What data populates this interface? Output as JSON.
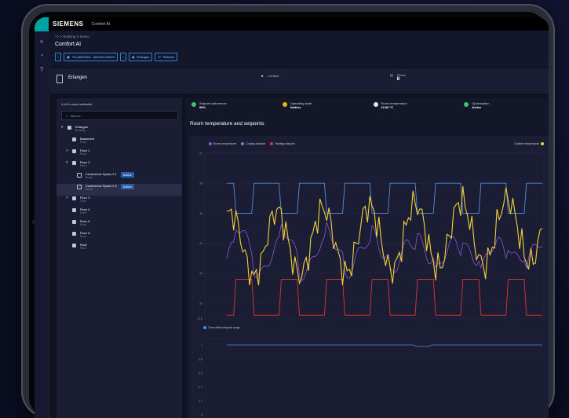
{
  "topbar": {
    "brand": "SIEMENS",
    "app": "Comfort AI"
  },
  "header": {
    "breadcrumb": ">> > Building X Demo",
    "title": "Comfort AI",
    "date_range": "Thu 8/8/2024 - Wed 8/14/2024",
    "location_button": "Erlangen",
    "refresh_button": "Refresh"
  },
  "info": {
    "building": "Erlangen",
    "contact_label": "Contact",
    "floors_label": "Floors",
    "floors_value": "8"
  },
  "left_panel": {
    "heading": "4 of 6 rooms activated",
    "search_placeholder": "Search...",
    "tree": [
      {
        "name": "Erlangen",
        "sub": "Building",
        "icon": "building-icon",
        "chevron": "v",
        "indent": 0
      },
      {
        "name": "Basement",
        "sub": "Floor",
        "icon": "floor-icon",
        "chevron": "",
        "indent": 1
      },
      {
        "name": "Floor 1",
        "sub": "Floor",
        "icon": "floor-icon",
        "chevron": ">",
        "indent": 1
      },
      {
        "name": "Floor 2",
        "sub": "Floor",
        "icon": "floor-icon",
        "chevron": "v",
        "indent": 1
      },
      {
        "name": "Conference Space 2.1",
        "sub": "Room",
        "icon": "room-icon",
        "chevron": "",
        "indent": 2,
        "badge": "Active"
      },
      {
        "name": "Conference Space 2.2",
        "sub": "Room",
        "icon": "room-icon",
        "chevron": "",
        "indent": 2,
        "badge": "Active",
        "selected": true
      },
      {
        "name": "Floor 3",
        "sub": "Floor",
        "icon": "floor-icon",
        "chevron": ">",
        "indent": 1
      },
      {
        "name": "Floor 4",
        "sub": "Floor",
        "icon": "floor-icon",
        "chevron": "",
        "indent": 1
      },
      {
        "name": "Floor 5",
        "sub": "Floor",
        "icon": "floor-icon",
        "chevron": "",
        "indent": 1
      },
      {
        "name": "Floor 6",
        "sub": "Floor",
        "icon": "floor-icon",
        "chevron": "",
        "indent": 1
      },
      {
        "name": "Roof",
        "sub": "Floor",
        "icon": "floor-icon",
        "chevron": "",
        "indent": 1
      }
    ]
  },
  "kpis": [
    {
      "label": "Setpoint adherence",
      "value": "99%",
      "color": "#3ec46d",
      "icon": "smile-icon"
    },
    {
      "label": "Operating state",
      "value": "Neither",
      "color": "#e8b400",
      "icon": "sun-icon"
    },
    {
      "label": "Room temperature",
      "value": "22.50 °C",
      "color": "#dfe3f2",
      "icon": "thermometer-icon"
    },
    {
      "label": "Optimization",
      "value": "Active",
      "color": "#3ec46d",
      "icon": "optimization-icon"
    }
  ],
  "chart_title": "Room temperature and setpoints",
  "chart_data": {
    "type": "line",
    "legend": [
      "Room temperature",
      "Cooling setpoint",
      "Heating setpoint",
      "Outside temperature"
    ],
    "colors": {
      "room": "#8b55d9",
      "cooling": "#4f8fe0",
      "heating": "#e03535",
      "outside": "#f2d23a"
    },
    "yticks": [
      "27",
      "26",
      "25",
      "24",
      "23",
      "22",
      "21.5"
    ],
    "ylim": [
      21.5,
      27
    ],
    "second_legend": "Time within setpoint range",
    "second_yticks": [
      "1",
      "0.8",
      "0.6",
      "0.4",
      "0.2",
      "0"
    ]
  }
}
